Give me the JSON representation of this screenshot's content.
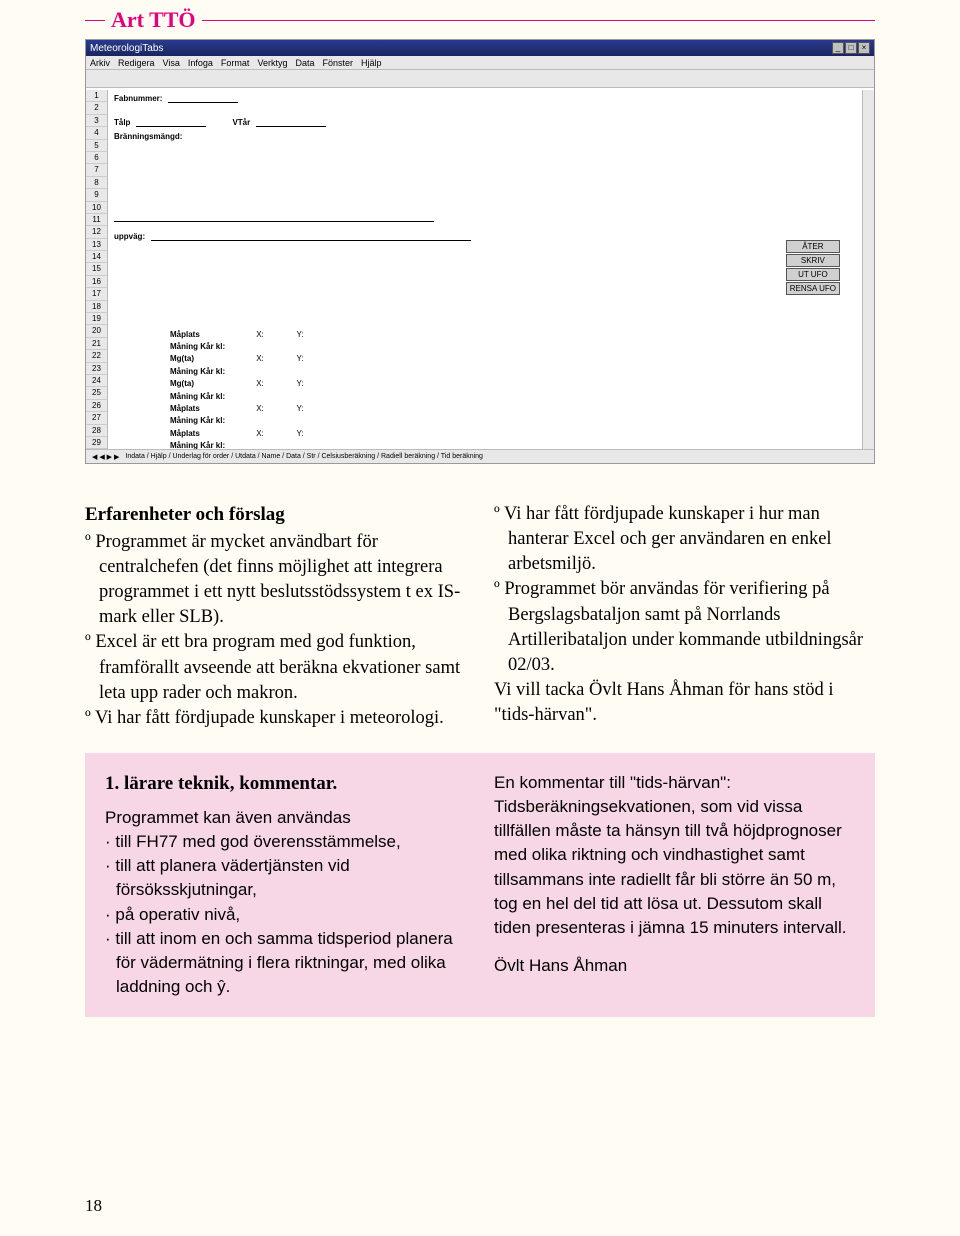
{
  "header": {
    "title": "Art TTÖ"
  },
  "screenshot": {
    "windowTitle": "MeteorologiTabs",
    "menubar": [
      "Arkiv",
      "Redigera",
      "Visa",
      "Infoga",
      "Format",
      "Verktyg",
      "Data",
      "Fönster",
      "Hjälp"
    ],
    "form": {
      "field1_label": "Fabnummer:",
      "field2_label": "Tålp",
      "field3_label": "VTår",
      "field4_label": "Bränningsmängd:",
      "field5_label": "uppväg:"
    },
    "buttons": [
      "ÅTER",
      "SKRIV",
      "UT UFO",
      "RENSA UFO"
    ],
    "mgrid_rows": [
      {
        "lbl": "Måplats",
        "x": "X:",
        "y": "Y:"
      },
      {
        "lbl": "Måning Kår kl:",
        "x": "",
        "y": ""
      },
      {
        "lbl": "Mg(ta)",
        "x": "X:",
        "y": "Y:"
      },
      {
        "lbl": "Måning Kår kl:",
        "x": "",
        "y": ""
      },
      {
        "lbl": "Mg(ta)",
        "x": "X:",
        "y": "Y:"
      },
      {
        "lbl": "Måning Kår kl:",
        "x": "",
        "y": ""
      },
      {
        "lbl": "Måplats",
        "x": "X:",
        "y": "Y:"
      },
      {
        "lbl": "Måning Kår kl:",
        "x": "",
        "y": ""
      },
      {
        "lbl": "Måplats",
        "x": "X:",
        "y": "Y:"
      },
      {
        "lbl": "Måning Kår kl:",
        "x": "",
        "y": ""
      }
    ],
    "tabs_text": "Indata / Hjälp / Underlag för order / Utdata / Name / Data / Str / Celsiusberäkning / Radiell beräkning / Tid beräkning"
  },
  "body": {
    "col_heading": "Erfarenheter och förslag",
    "b1": "º Programmet är mycket användbart för centralchefen (det finns möjlighet att integrera programmet i ett nytt beslutsstödssystem t ex IS-mark eller SLB).",
    "b2": "º Excel är ett bra program med god funktion, framförallt avseende att beräkna ekvationer samt leta upp rader och makron.",
    "b3": "º Vi har fått fördjupade kunskaper i meteorologi.",
    "b4": "º Vi har fått fördjupade kunskaper i hur man hanterar Excel och ger användaren en enkel arbetsmiljö.",
    "b5": "º Programmet bör användas för verifiering på Bergslagsbataljon samt på Norrlands Artilleribataljon under kommande utbildningsår 02/03.",
    "thanks": "Vi vill tacka Övlt Hans Åhman för hans stöd i \"tids-härvan\"."
  },
  "pinkbox": {
    "heading": "1. lärare teknik, kommentar.",
    "intro": "Programmet kan även användas",
    "p1": "· till FH77 med god överensstämmelse,",
    "p2": "· till att planera vädertjänsten vid försöksskjutningar,",
    "p3": "· på operativ nivå,",
    "p4": "· till att inom en och samma tidsperiod planera för vädermätning i flera riktningar, med olika laddning och ŷ.",
    "right1": "En kommentar till \"tids-härvan\": Tidsberäkningsekvationen, som vid vissa tillfällen måste ta hänsyn till två höjdprognoser med olika riktning och vindhastighet samt tillsammans inte radiellt får bli större än 50 m, tog en hel del tid att lösa ut. Dessutom skall tiden presenteras i jämna 15 minuters intervall.",
    "sign": "Övlt Hans Åhman"
  },
  "pagenum": "18"
}
